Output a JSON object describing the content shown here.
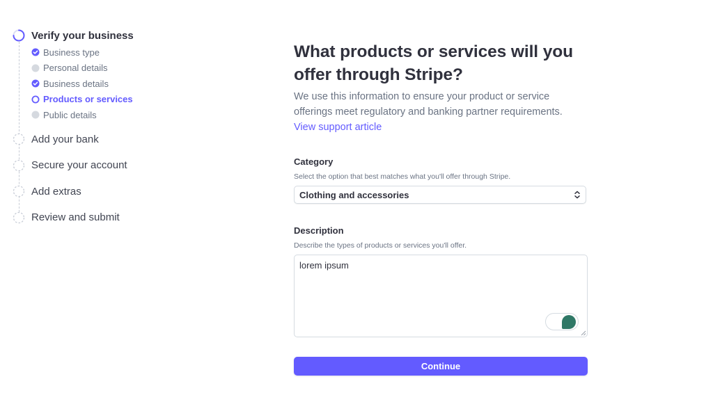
{
  "colors": {
    "accent": "#635bff",
    "text_primary": "#30313d",
    "text_secondary": "#6a7383",
    "pending": "#d5d9df",
    "toggle": "#2f7866"
  },
  "sidebar": {
    "active_step": {
      "label": "Verify your business",
      "icon": "progress-ring-icon",
      "substeps": [
        {
          "label": "Business type",
          "status": "complete",
          "icon": "check-circle-icon"
        },
        {
          "label": "Personal details",
          "status": "pending",
          "icon": "gray-dot-icon"
        },
        {
          "label": "Business details",
          "status": "complete",
          "icon": "check-circle-icon"
        },
        {
          "label": "Products or services",
          "status": "current",
          "icon": "ring-icon"
        },
        {
          "label": "Public details",
          "status": "pending",
          "icon": "gray-dot-icon"
        }
      ]
    },
    "steps": [
      {
        "label": "Add your bank",
        "icon": "dashed-circle-icon"
      },
      {
        "label": "Secure your account",
        "icon": "dashed-circle-icon"
      },
      {
        "label": "Add extras",
        "icon": "dashed-circle-icon"
      },
      {
        "label": "Review and submit",
        "icon": "dashed-circle-icon"
      }
    ]
  },
  "main": {
    "heading": "What products or services will you offer through Stripe?",
    "intro": "We use this information to ensure your product or service offerings meet regulatory and banking partner requirements.",
    "support_link": "View support article",
    "category": {
      "label": "Category",
      "help": "Select the option that best matches what you'll offer through Stripe.",
      "selected": "Clothing and accessories",
      "icon": "chevron-up-down-icon"
    },
    "description": {
      "label": "Description",
      "help": "Describe the types of products or services you'll offer.",
      "value": "lorem ipsum",
      "widget_icon": "grammar-assistant-icon"
    },
    "continue_label": "Continue"
  }
}
